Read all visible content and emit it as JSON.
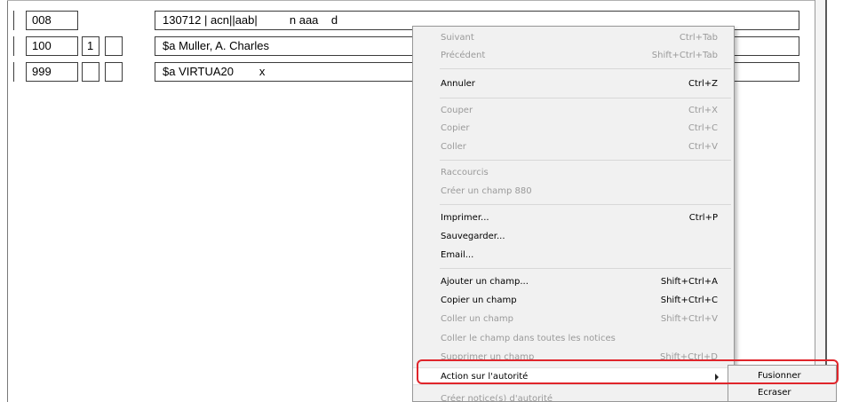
{
  "records": [
    {
      "tag": "008",
      "ind1": "",
      "ind2": "",
      "data": "130712 | acn||aab|          n aaa    d"
    },
    {
      "tag": "100",
      "ind1": "1",
      "ind2": "",
      "data": "$a Muller, A. Charles"
    },
    {
      "tag": "999",
      "ind1": "",
      "ind2": "",
      "data": "$a VIRTUA20        x"
    }
  ],
  "context_menu": {
    "items": [
      {
        "label": "Suivant",
        "shortcut": "Ctrl+Tab",
        "enabled": false
      },
      {
        "label": "Précédent",
        "shortcut": "Shift+Ctrl+Tab",
        "enabled": false
      },
      {
        "label": "Annuler",
        "shortcut": "Ctrl+Z",
        "enabled": true
      },
      {
        "label": "Couper",
        "shortcut": "Ctrl+X",
        "enabled": false
      },
      {
        "label": "Copier",
        "shortcut": "Ctrl+C",
        "enabled": false
      },
      {
        "label": "Coller",
        "shortcut": "Ctrl+V",
        "enabled": false
      },
      {
        "label": "Raccourcis",
        "shortcut": "",
        "enabled": false
      },
      {
        "label": "Créer un champ 880",
        "shortcut": "",
        "enabled": false
      },
      {
        "label": "Imprimer...",
        "shortcut": "Ctrl+P",
        "enabled": true
      },
      {
        "label": "Sauvegarder...",
        "shortcut": "",
        "enabled": true
      },
      {
        "label": "Email...",
        "shortcut": "",
        "enabled": true
      },
      {
        "label": "Ajouter un champ...",
        "shortcut": "Shift+Ctrl+A",
        "enabled": true
      },
      {
        "label": "Copier un champ",
        "shortcut": "Shift+Ctrl+C",
        "enabled": true
      },
      {
        "label": "Coller un champ",
        "shortcut": "Shift+Ctrl+V",
        "enabled": false
      },
      {
        "label": "Coller le champ dans toutes les notices",
        "shortcut": "",
        "enabled": false
      },
      {
        "label": "Supprimer un champ",
        "shortcut": "Shift+Ctrl+D",
        "enabled": false
      },
      {
        "label": "Action sur l'autorité",
        "shortcut": "",
        "enabled": true,
        "has_submenu": true,
        "highlighted": true
      },
      {
        "label": "Créer notice(s) d'autorité",
        "shortcut": "",
        "enabled": false
      }
    ]
  },
  "submenu": {
    "items": [
      {
        "label": "Fusionner",
        "highlighted": true
      },
      {
        "label": "Ecraser",
        "highlighted": false
      }
    ]
  },
  "colors": {
    "menu_background": "#f1f1f1",
    "disabled_text": "#9a9a9a",
    "highlight_outline": "#e0252b"
  }
}
